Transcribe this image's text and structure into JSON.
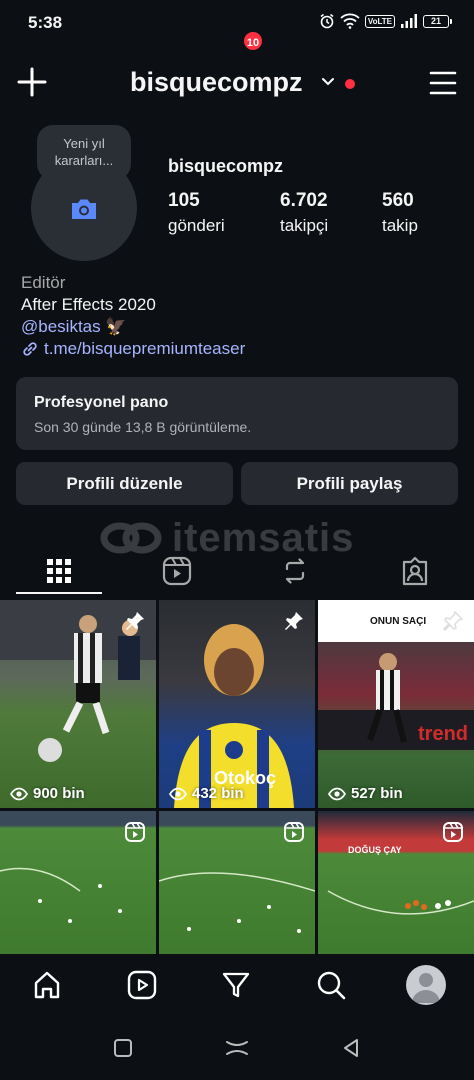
{
  "status_bar": {
    "time": "5:38",
    "network_label": "VoLTE",
    "battery_percent": "21"
  },
  "header": {
    "username": "bisquecompz"
  },
  "profile": {
    "note": "Yeni yıl kararları...",
    "name": "bisquecompz",
    "stats": [
      {
        "value": "105",
        "label": "gönderi"
      },
      {
        "value": "6.702",
        "label": "takipçi"
      },
      {
        "value": "560",
        "label": "takip"
      }
    ],
    "bio": {
      "category": "Editör",
      "line1": "After Effects 2020",
      "mention": "@besiktas",
      "mention_emoji": "🦅",
      "link": "t.me/bisquepremiumteaser"
    }
  },
  "dashboard": {
    "title": "Profesyonel pano",
    "subtitle": "Son 30 günde 13,8 B görüntüleme."
  },
  "buttons": {
    "edit_profile": "Profili düzenle",
    "share_profile": "Profili paylaş"
  },
  "watermark": {
    "text": "itemsatis"
  },
  "posts": [
    {
      "views": "900 bin",
      "pinned": true,
      "type": "reel"
    },
    {
      "views": "432 bin",
      "pinned": true,
      "type": "reel",
      "overlay": "Otokoç"
    },
    {
      "views": "527 bin",
      "pinned": true,
      "type": "reel",
      "overlay": "ONUN SAÇI"
    },
    {
      "views": "",
      "pinned": false,
      "type": "reel"
    },
    {
      "views": "",
      "pinned": false,
      "type": "reel"
    },
    {
      "views": "",
      "pinned": false,
      "type": "reel",
      "overlay": "DOĞUŞ ÇAY"
    }
  ],
  "nav": {
    "notification_count": "10"
  },
  "colors": {
    "background": "#0c1014",
    "surface": "#262a30",
    "link": "#a7b4ff",
    "notification": "#ff3040"
  }
}
